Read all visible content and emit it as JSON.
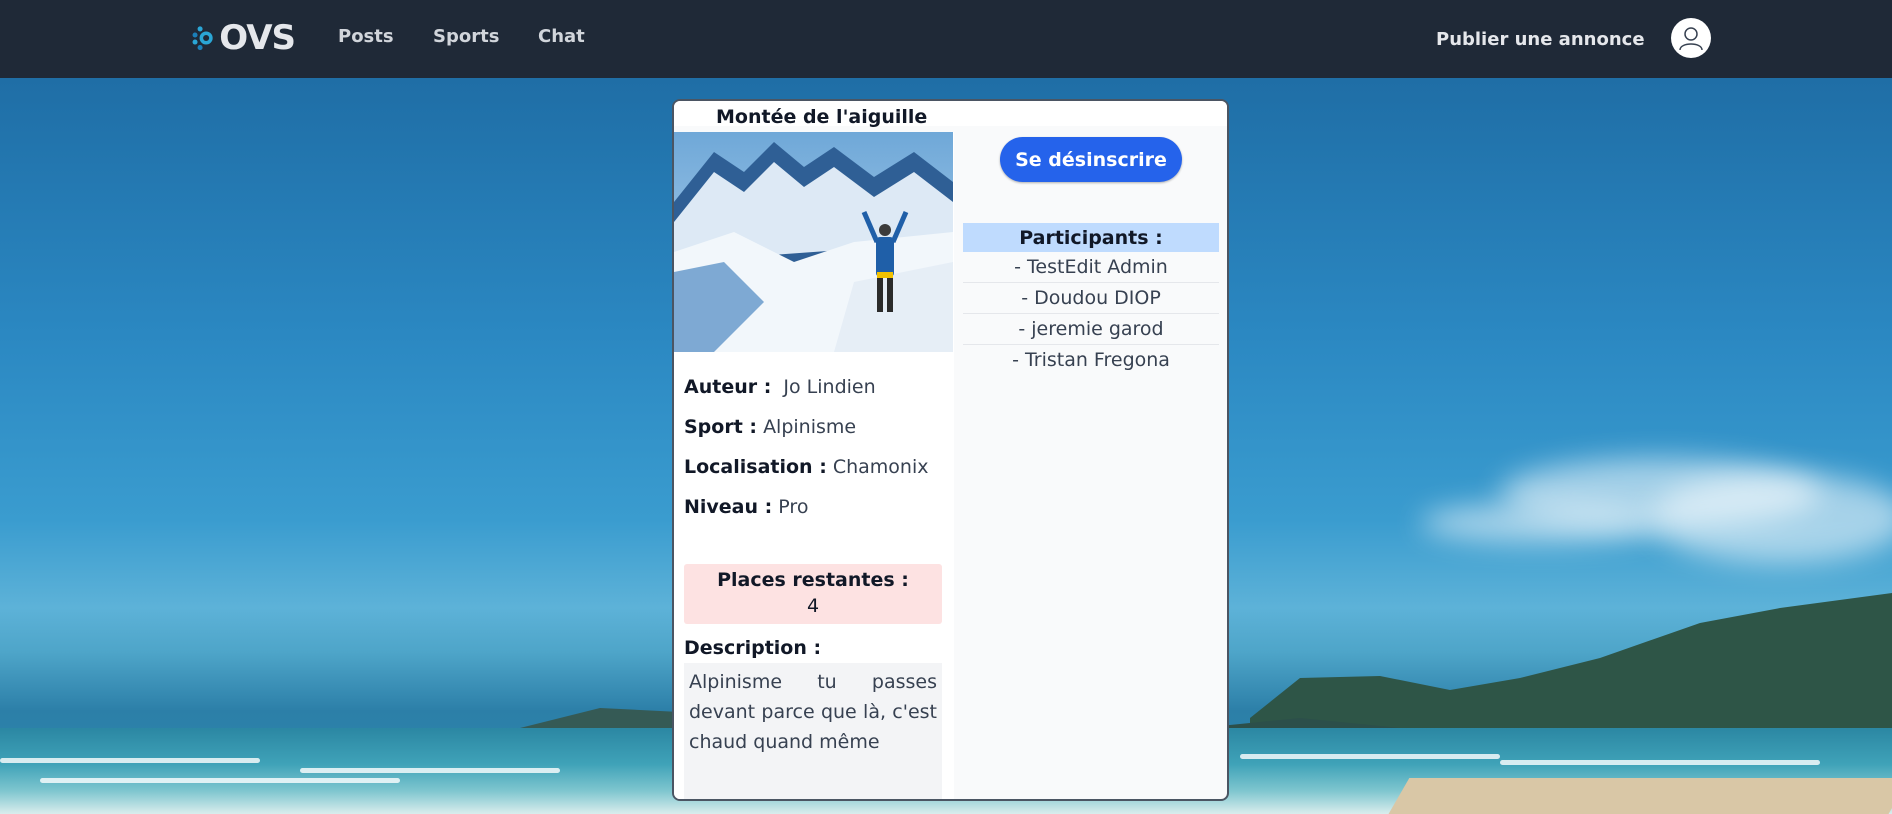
{
  "nav": {
    "logo_text": "OVS",
    "links": [
      "Posts",
      "Sports",
      "Chat"
    ],
    "publish_label": "Publier une annonce"
  },
  "post": {
    "title": "Montée de l'aiguille",
    "author_label": "Auteur :",
    "author": "Jo Lindien",
    "sport_label": "Sport :",
    "sport": "Alpinisme",
    "location_label": "Localisation :",
    "location": "Chamonix",
    "level_label": "Niveau :",
    "level": "Pro",
    "places_label": "Places restantes :",
    "places": "4",
    "description_label": "Description :",
    "description": "Alpinisme tu passes devant parce que là, c'est chaud quand même"
  },
  "action": {
    "unsubscribe_label": "Se désinscrire"
  },
  "participants": {
    "header": "Participants :",
    "items": [
      "- TestEdit Admin",
      "- Doudou DIOP",
      "- jeremie garod",
      "- Tristan Fregona"
    ]
  },
  "colors": {
    "navbar": "#1f2937",
    "primary_button": "#2563eb",
    "participants_header": "#bfdbfe",
    "places_bg": "#fde2e2"
  }
}
